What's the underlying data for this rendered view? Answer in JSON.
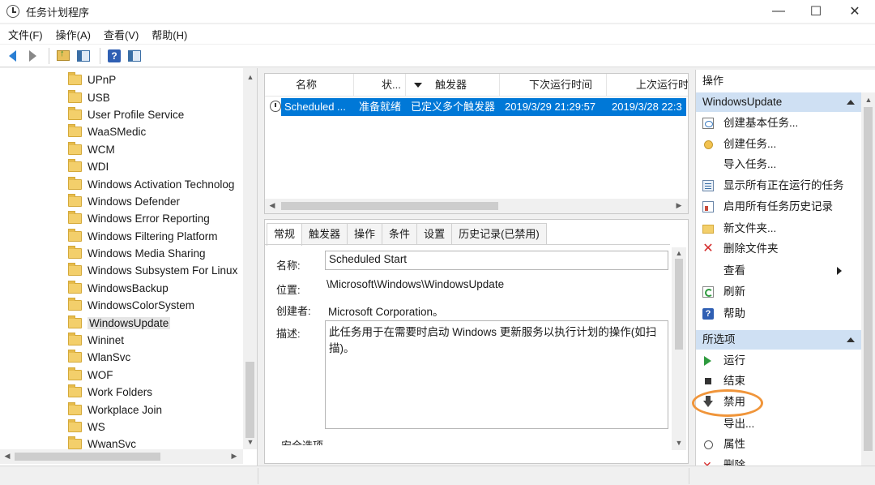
{
  "window": {
    "title": "任务计划程序",
    "minimize": "—",
    "maximize": "☐",
    "close": "✕"
  },
  "menu": [
    "文件(F)",
    "操作(A)",
    "查看(V)",
    "帮助(H)"
  ],
  "toolbar": [
    "back-icon",
    "forward-icon",
    "folder-up-icon",
    "console-tree-icon",
    "help-icon",
    "action-pane-icon"
  ],
  "tree": {
    "items": [
      "UPnP",
      "USB",
      "User Profile Service",
      "WaaSMedic",
      "WCM",
      "WDI",
      "Windows Activation Technolog",
      "Windows Defender",
      "Windows Error Reporting",
      "Windows Filtering Platform",
      "Windows Media Sharing",
      "Windows Subsystem For Linux",
      "WindowsBackup",
      "WindowsColorSystem",
      "WindowsUpdate",
      "Wininet",
      "WlanSvc",
      "WOF",
      "Work Folders",
      "Workplace Join",
      "WS",
      "WwanSvc"
    ],
    "selected": "WindowsUpdate"
  },
  "task_list": {
    "columns": [
      "名称",
      "状...",
      "触发器",
      "下次运行时间",
      "上次运行时"
    ],
    "rows": [
      {
        "name": "Scheduled ...",
        "status": "准备就绪",
        "trigger": "已定义多个触发器",
        "next_run": "2019/3/29 21:29:57",
        "last_run": "2019/3/28 22:3"
      }
    ]
  },
  "details": {
    "tabs": [
      "常规",
      "触发器",
      "操作",
      "条件",
      "设置",
      "历史记录(已禁用)"
    ],
    "name_label": "名称:",
    "name_value": "Scheduled Start",
    "location_label": "位置:",
    "location_value": "\\Microsoft\\Windows\\WindowsUpdate",
    "author_label": "创建者:",
    "author_value": "Microsoft Corporation。",
    "desc_label": "描述:",
    "desc_value": "此任务用于在需要时启动 Windows 更新服务以执行计划的操作(如扫描)。",
    "cut_label": "安全选项"
  },
  "actions": {
    "title": "操作",
    "section1": {
      "header": "WindowsUpdate",
      "items": [
        {
          "label": "创建基本任务...",
          "icon": "basic-task-icon"
        },
        {
          "label": "创建任务...",
          "icon": "create-task-icon"
        },
        {
          "label": "导入任务...",
          "icon": ""
        },
        {
          "label": "显示所有正在运行的任务",
          "icon": "running-tasks-icon"
        },
        {
          "label": "启用所有任务历史记录",
          "icon": "history-icon"
        },
        {
          "label": "新文件夹...",
          "icon": "folder-icon"
        },
        {
          "label": "删除文件夹",
          "icon": "delete-icon"
        },
        {
          "label": "查看",
          "icon": ""
        },
        {
          "label": "刷新",
          "icon": "refresh-icon"
        },
        {
          "label": "帮助",
          "icon": "help-icon"
        }
      ]
    },
    "section2": {
      "header": "所选项",
      "items": [
        {
          "label": "运行",
          "icon": "run-icon"
        },
        {
          "label": "结束",
          "icon": "stop-icon"
        },
        {
          "label": "禁用",
          "icon": "disable-icon"
        },
        {
          "label": "导出...",
          "icon": ""
        },
        {
          "label": "属性",
          "icon": "properties-icon"
        },
        {
          "label": "删除",
          "icon": "remove-icon"
        }
      ]
    }
  },
  "highlight_color": "#f0953a",
  "selection_color": "#0078d7",
  "section_header_color": "#cfe0f3"
}
